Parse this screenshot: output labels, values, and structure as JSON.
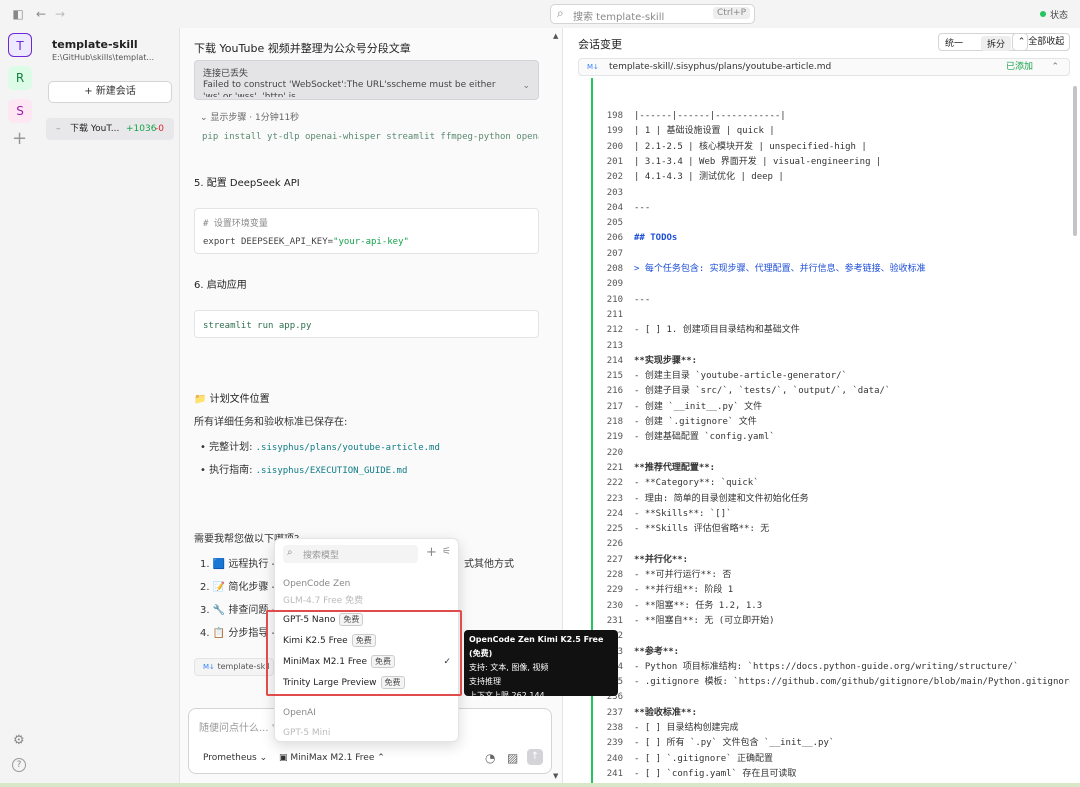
{
  "topbar": {
    "search_placeholder": "搜索 template-skill",
    "search_shortcut": "Ctrl+P",
    "status_label": "状态"
  },
  "rail": {
    "avatars": [
      {
        "letter": "T",
        "color": "#6d28d9",
        "bg": "#ede9fe"
      },
      {
        "letter": "R",
        "color": "#15803d",
        "bg": "#dcfce7"
      },
      {
        "letter": "S",
        "color": "#a21caf",
        "bg": "#fce7f3"
      }
    ]
  },
  "sidebar": {
    "project_title": "template-skill",
    "project_path": "E:\\GitHub\\skills\\templat...",
    "new_session_label": "+ 新建会话",
    "session": {
      "dash": "–",
      "name": "下载 YouT...",
      "added": "+1036",
      "removed": "-0"
    }
  },
  "chat": {
    "title": "下载 YouTube 视频并整理为公众号分段文章",
    "error_title": "连接已丢失",
    "error_detail": "Failed to construct 'WebSocket':The URL'sscheme must be either 'ws' or 'wss'. 'http' is",
    "steps_label": "显示步骤 · 1分钟11秒",
    "pip_command": "pip install yt-dlp openai-whisper streamlit ffmpeg-python openai pyt",
    "section5_title": "5. 配置 DeepSeek API",
    "env_comment": "# 设置环境变量",
    "env_export": "export",
    "env_assign": "DEEPSEEK_API_KEY=",
    "env_value": "\"your-api-key\"",
    "section6_title": "6. 启动应用",
    "run_cmd": "streamlit run app.py",
    "plan_heading": "📁 计划文件位置",
    "plan_desc": "所有详细任务和验收标准已保存在:",
    "plan_full_label": "完整计划: ",
    "plan_full_path": ".sisyphus/plans/youtube-article.md",
    "plan_guide_label": "执行指南: ",
    "plan_guide_path": ".sisyphus/EXECUTION_GUIDE.md",
    "question": "需要我帮您做以下哪项?",
    "options": [
      "1. 🟦 远程执行 -",
      "2. 📝 简化步骤 -",
      "3. 🔧 排查问题 -",
      "4. 📋 分步指导 -"
    ],
    "option1_tail": "式其他方式",
    "file_chip_tag": "M↓",
    "file_chip": "template-skil",
    "composer_placeholder": "随便问点什么... \"帮",
    "agent": "Prometheus ⌄",
    "model": "MiniMax M2.1 Free ⌃"
  },
  "dropdown": {
    "search_placeholder": "搜索模型",
    "group1": "OpenCode Zen",
    "faded_item": "GLM-4.7 Free  免费",
    "items": [
      {
        "name": "GPT-5 Nano",
        "badge": "免费",
        "selected": false
      },
      {
        "name": "Kimi K2.5 Free",
        "badge": "免费",
        "selected": false
      },
      {
        "name": "MiniMax M2.1 Free",
        "badge": "免费",
        "selected": true
      },
      {
        "name": "Trinity Large Preview",
        "badge": "免费",
        "selected": false
      }
    ],
    "group2": "OpenAI",
    "faded_item2": "GPT-5 Mini"
  },
  "tooltip": {
    "title": "OpenCode Zen Kimi K2.5 Free (免费)",
    "support": "支持: 文本, 图像, 视频",
    "reasoning": "支持推理",
    "context": "上下文上限 262,144"
  },
  "right": {
    "title": "会话变更",
    "seg_unified": "统一",
    "seg_split": "拆分",
    "collapse_all": "全部收起",
    "file_tag": "M↓",
    "file_path": "template-skill/.sisyphus/plans/youtube-article.md",
    "file_status": "已添加",
    "lines": [
      {
        "n": "198",
        "t": "|------|------|------------|",
        "s": ""
      },
      {
        "n": "199",
        "t": "| 1 | 基础设施设置 | quick |",
        "s": ""
      },
      {
        "n": "200",
        "t": "| 2.1-2.5 | 核心模块开发 | unspecified-high |",
        "s": ""
      },
      {
        "n": "201",
        "t": "| 3.1-3.4 | Web 界面开发 | visual-engineering |",
        "s": ""
      },
      {
        "n": "202",
        "t": "| 4.1-4.3 | 测试优化 | deep |",
        "s": ""
      },
      {
        "n": "203",
        "t": "",
        "s": ""
      },
      {
        "n": "204",
        "t": "---",
        "s": ""
      },
      {
        "n": "205",
        "t": "",
        "s": ""
      },
      {
        "n": "206",
        "t": "## TODOs",
        "s": "blue bold"
      },
      {
        "n": "207",
        "t": "",
        "s": ""
      },
      {
        "n": "208",
        "t": "> 每个任务包含: 实现步骤、代理配置、并行信息、参考链接、验收标准",
        "s": "blue"
      },
      {
        "n": "209",
        "t": "",
        "s": ""
      },
      {
        "n": "210",
        "t": "---",
        "s": ""
      },
      {
        "n": "211",
        "t": "",
        "s": ""
      },
      {
        "n": "212",
        "t": "- [ ] 1. 创建项目目录结构和基础文件",
        "s": ""
      },
      {
        "n": "213",
        "t": "",
        "s": ""
      },
      {
        "n": "214",
        "t": "  **实现步骤**:",
        "s": "bold"
      },
      {
        "n": "215",
        "t": "  - 创建主目录 `youtube-article-generator/`",
        "s": ""
      },
      {
        "n": "216",
        "t": "  - 创建子目录 `src/`, `tests/`, `output/`, `data/`",
        "s": ""
      },
      {
        "n": "217",
        "t": "  - 创建 `__init__.py` 文件",
        "s": ""
      },
      {
        "n": "218",
        "t": "  - 创建 `.gitignore` 文件",
        "s": ""
      },
      {
        "n": "219",
        "t": "  - 创建基础配置 `config.yaml`",
        "s": ""
      },
      {
        "n": "220",
        "t": "",
        "s": ""
      },
      {
        "n": "221",
        "t": "  **推荐代理配置**:",
        "s": "bold"
      },
      {
        "n": "222",
        "t": "  - **Category**: `quick`",
        "s": ""
      },
      {
        "n": "223",
        "t": "    - 理由: 简单的目录创建和文件初始化任务",
        "s": ""
      },
      {
        "n": "224",
        "t": "  - **Skills**: `[]`",
        "s": ""
      },
      {
        "n": "225",
        "t": "  - **Skills 评估但省略**: 无",
        "s": ""
      },
      {
        "n": "226",
        "t": "",
        "s": ""
      },
      {
        "n": "227",
        "t": "  **并行化**:",
        "s": "bold"
      },
      {
        "n": "228",
        "t": "  - **可并行运行**: 否",
        "s": ""
      },
      {
        "n": "229",
        "t": "  - **并行组**: 阶段 1",
        "s": ""
      },
      {
        "n": "230",
        "t": "  - **阻塞**: 任务 1.2, 1.3",
        "s": ""
      },
      {
        "n": "231",
        "t": "  - **阻塞自**: 无 (可立即开始)",
        "s": ""
      },
      {
        "n": "232",
        "t": "",
        "s": ""
      },
      {
        "n": "233",
        "t": "  **参考**:",
        "s": "bold"
      },
      {
        "n": "234",
        "t": "  - Python 项目标准结构: `https://docs.python-guide.org/writing/structure/`",
        "s": ""
      },
      {
        "n": "235",
        "t": "  - .gitignore 模板: `https://github.com/github/gitignore/blob/main/Python.gitignore`",
        "s": ""
      },
      {
        "n": "236",
        "t": "",
        "s": ""
      },
      {
        "n": "237",
        "t": "  **验收标准**:",
        "s": "bold"
      },
      {
        "n": "238",
        "t": "  - [ ] 目录结构创建完成",
        "s": ""
      },
      {
        "n": "239",
        "t": "  - [ ] 所有 `.py` 文件包含 `__init__.py`",
        "s": ""
      },
      {
        "n": "240",
        "t": "  - [ ] `.gitignore` 正确配置",
        "s": ""
      },
      {
        "n": "241",
        "t": "  - [ ] `config.yaml` 存在且可读取",
        "s": ""
      },
      {
        "n": "242",
        "t": "",
        "s": ""
      },
      {
        "n": "243",
        "t": "---",
        "s": ""
      }
    ]
  }
}
